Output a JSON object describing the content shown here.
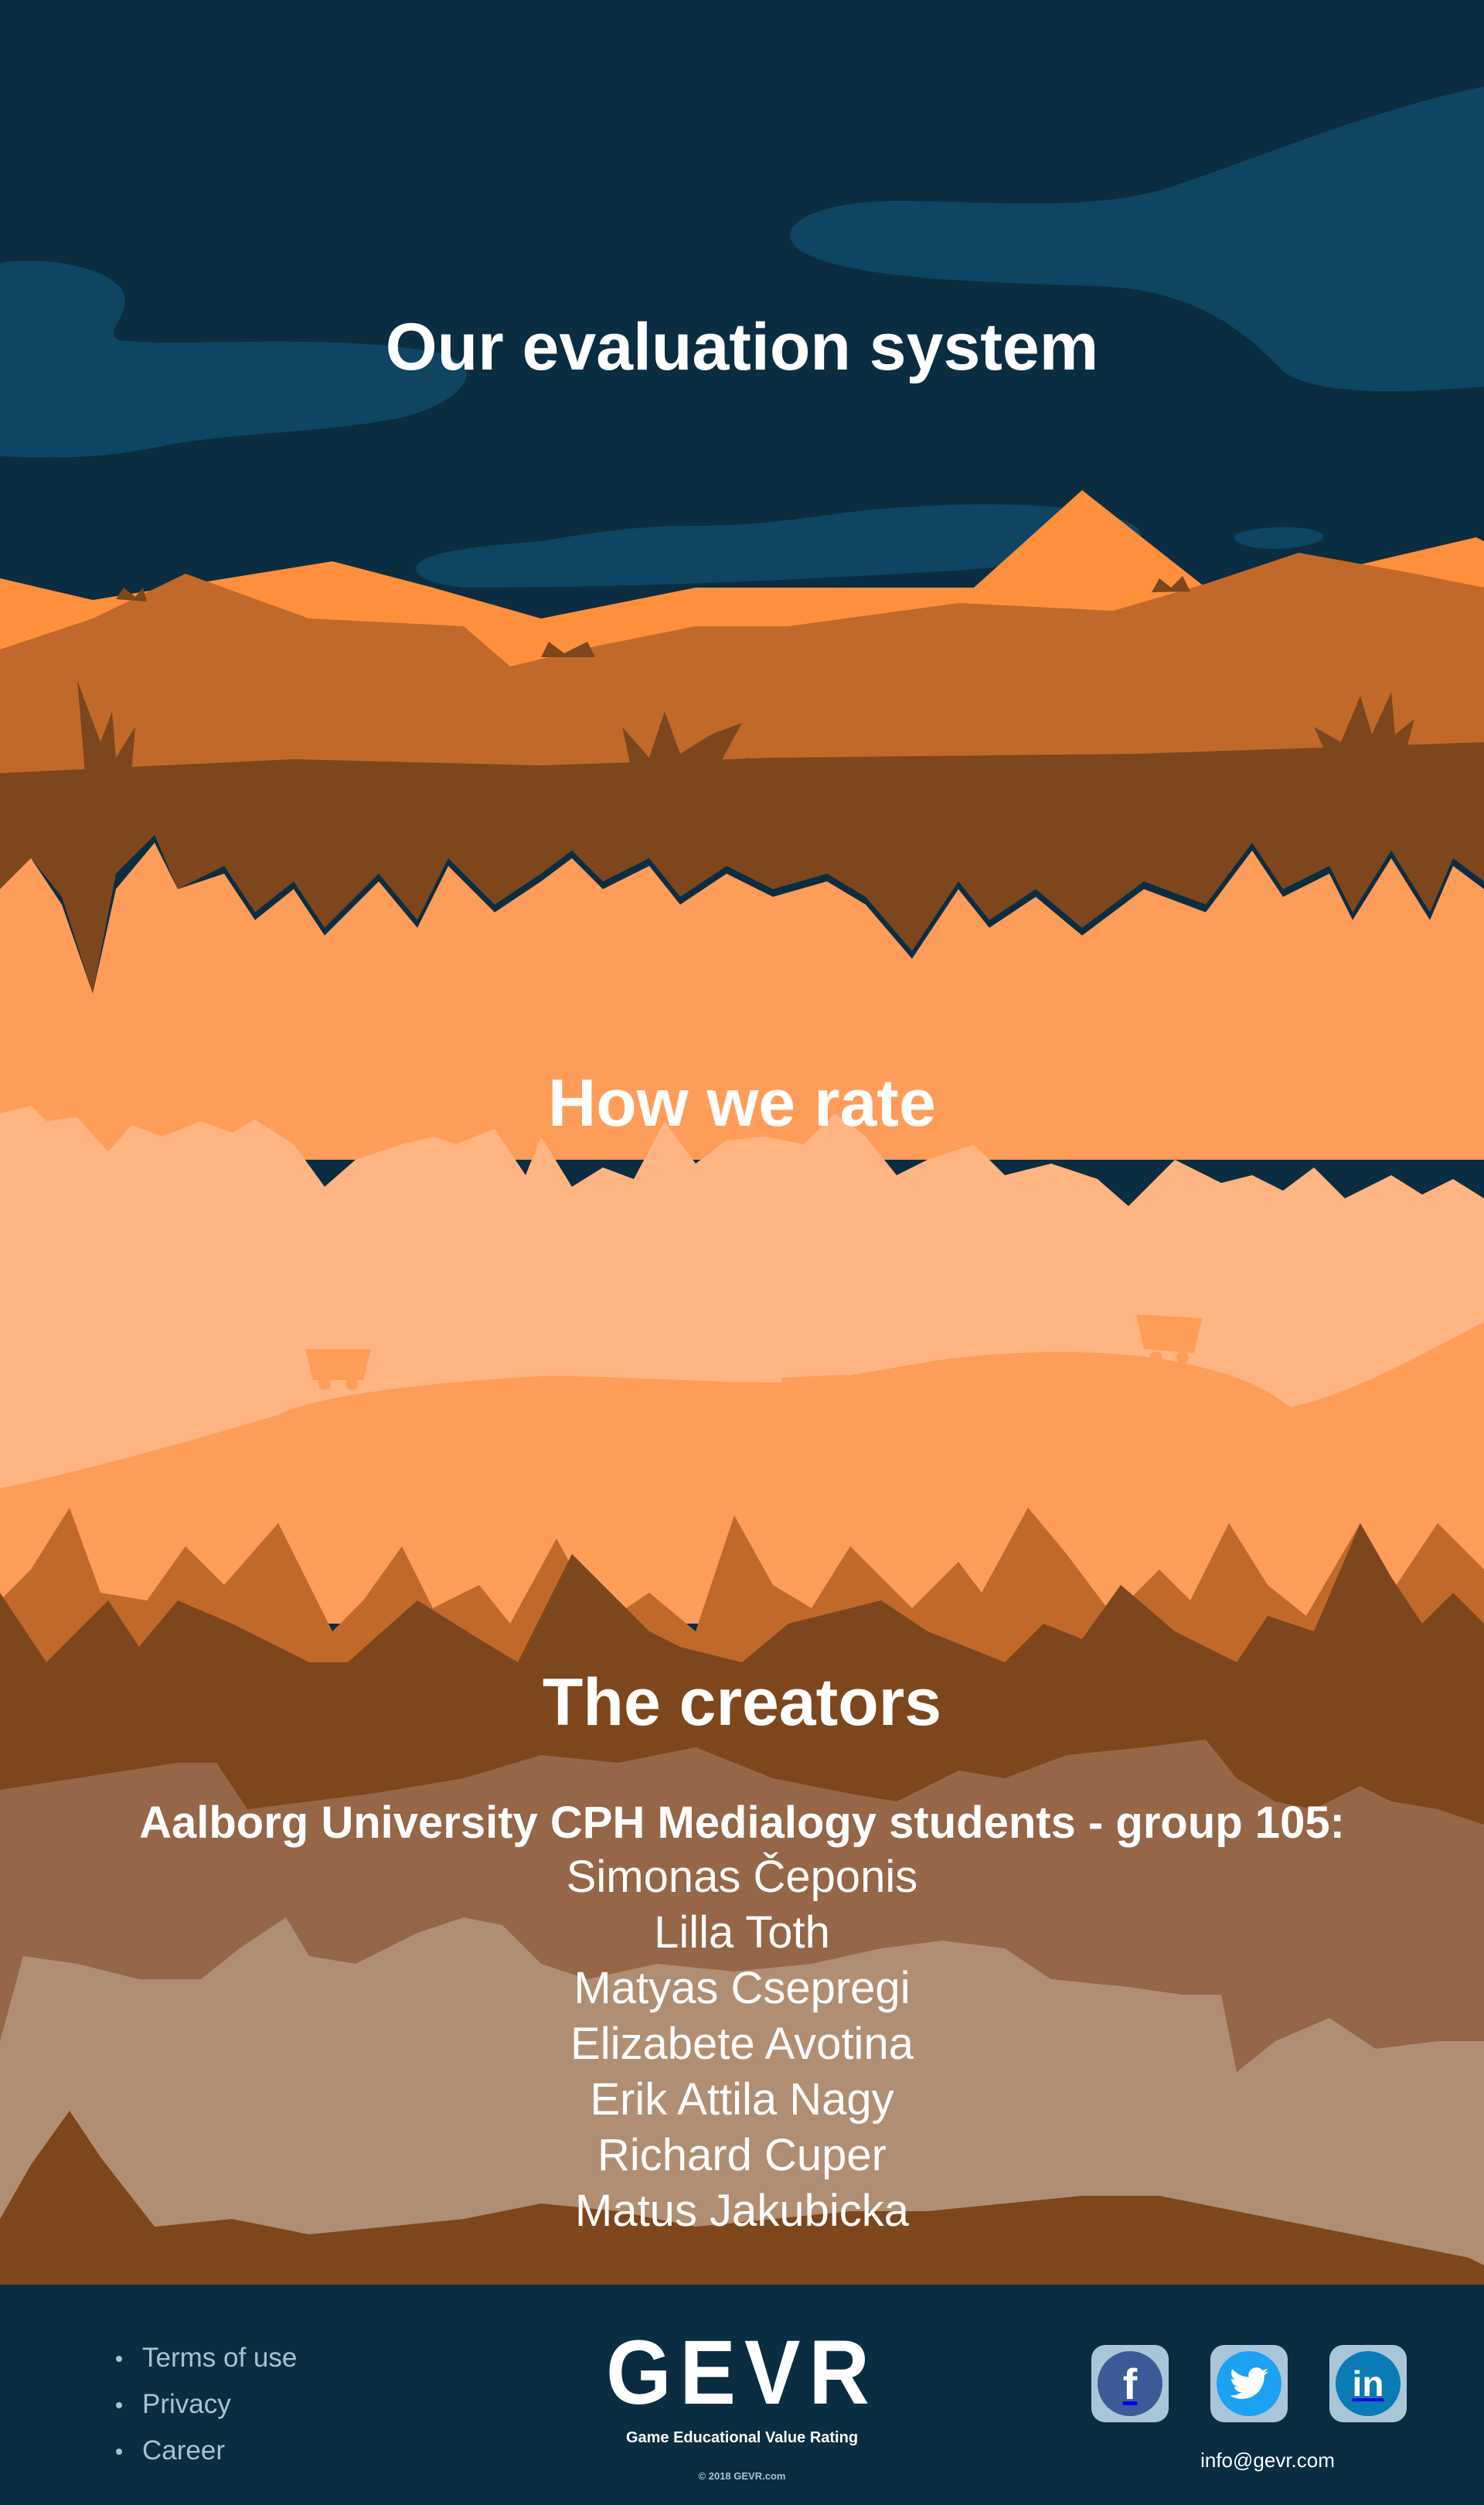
{
  "sections": {
    "evaluation": {
      "title": "Our evaluation system"
    },
    "rating": {
      "title": "How we rate"
    },
    "creators": {
      "title": "The creators",
      "subtitle": "Aalborg University CPH Medialogy students - group 105:",
      "members": [
        "Simonas Čeponis",
        "Lilla Toth",
        "Matyas Csepregi",
        "Elizabete Avotina",
        "Erik Attila Nagy",
        "Richard Cuper",
        "Matus Jakubicka"
      ]
    }
  },
  "footer": {
    "links": [
      "Terms of use",
      "Privacy",
      "Career"
    ],
    "logo": "GEVR",
    "tagline": "Game Educational Value Rating",
    "copyright": "© 2018 GEVR.com",
    "email": "info@gevr.com",
    "social": [
      {
        "name": "facebook",
        "icon": "facebook-icon",
        "glyph": "f"
      },
      {
        "name": "twitter",
        "icon": "twitter-icon",
        "glyph": ""
      },
      {
        "name": "linkedin",
        "icon": "linkedin-icon",
        "glyph": "in"
      }
    ]
  },
  "colors": {
    "night_sky": "#0b2d41",
    "cloud": "#0f4563",
    "peak_light": "#fe8f3c",
    "hill_mid": "#c0692b",
    "ground_dark": "#7e461c",
    "sand": "#fe9c5a",
    "sand_light": "#ffb482",
    "rock_brown": "#956647",
    "rock_light": "#b08e74"
  }
}
